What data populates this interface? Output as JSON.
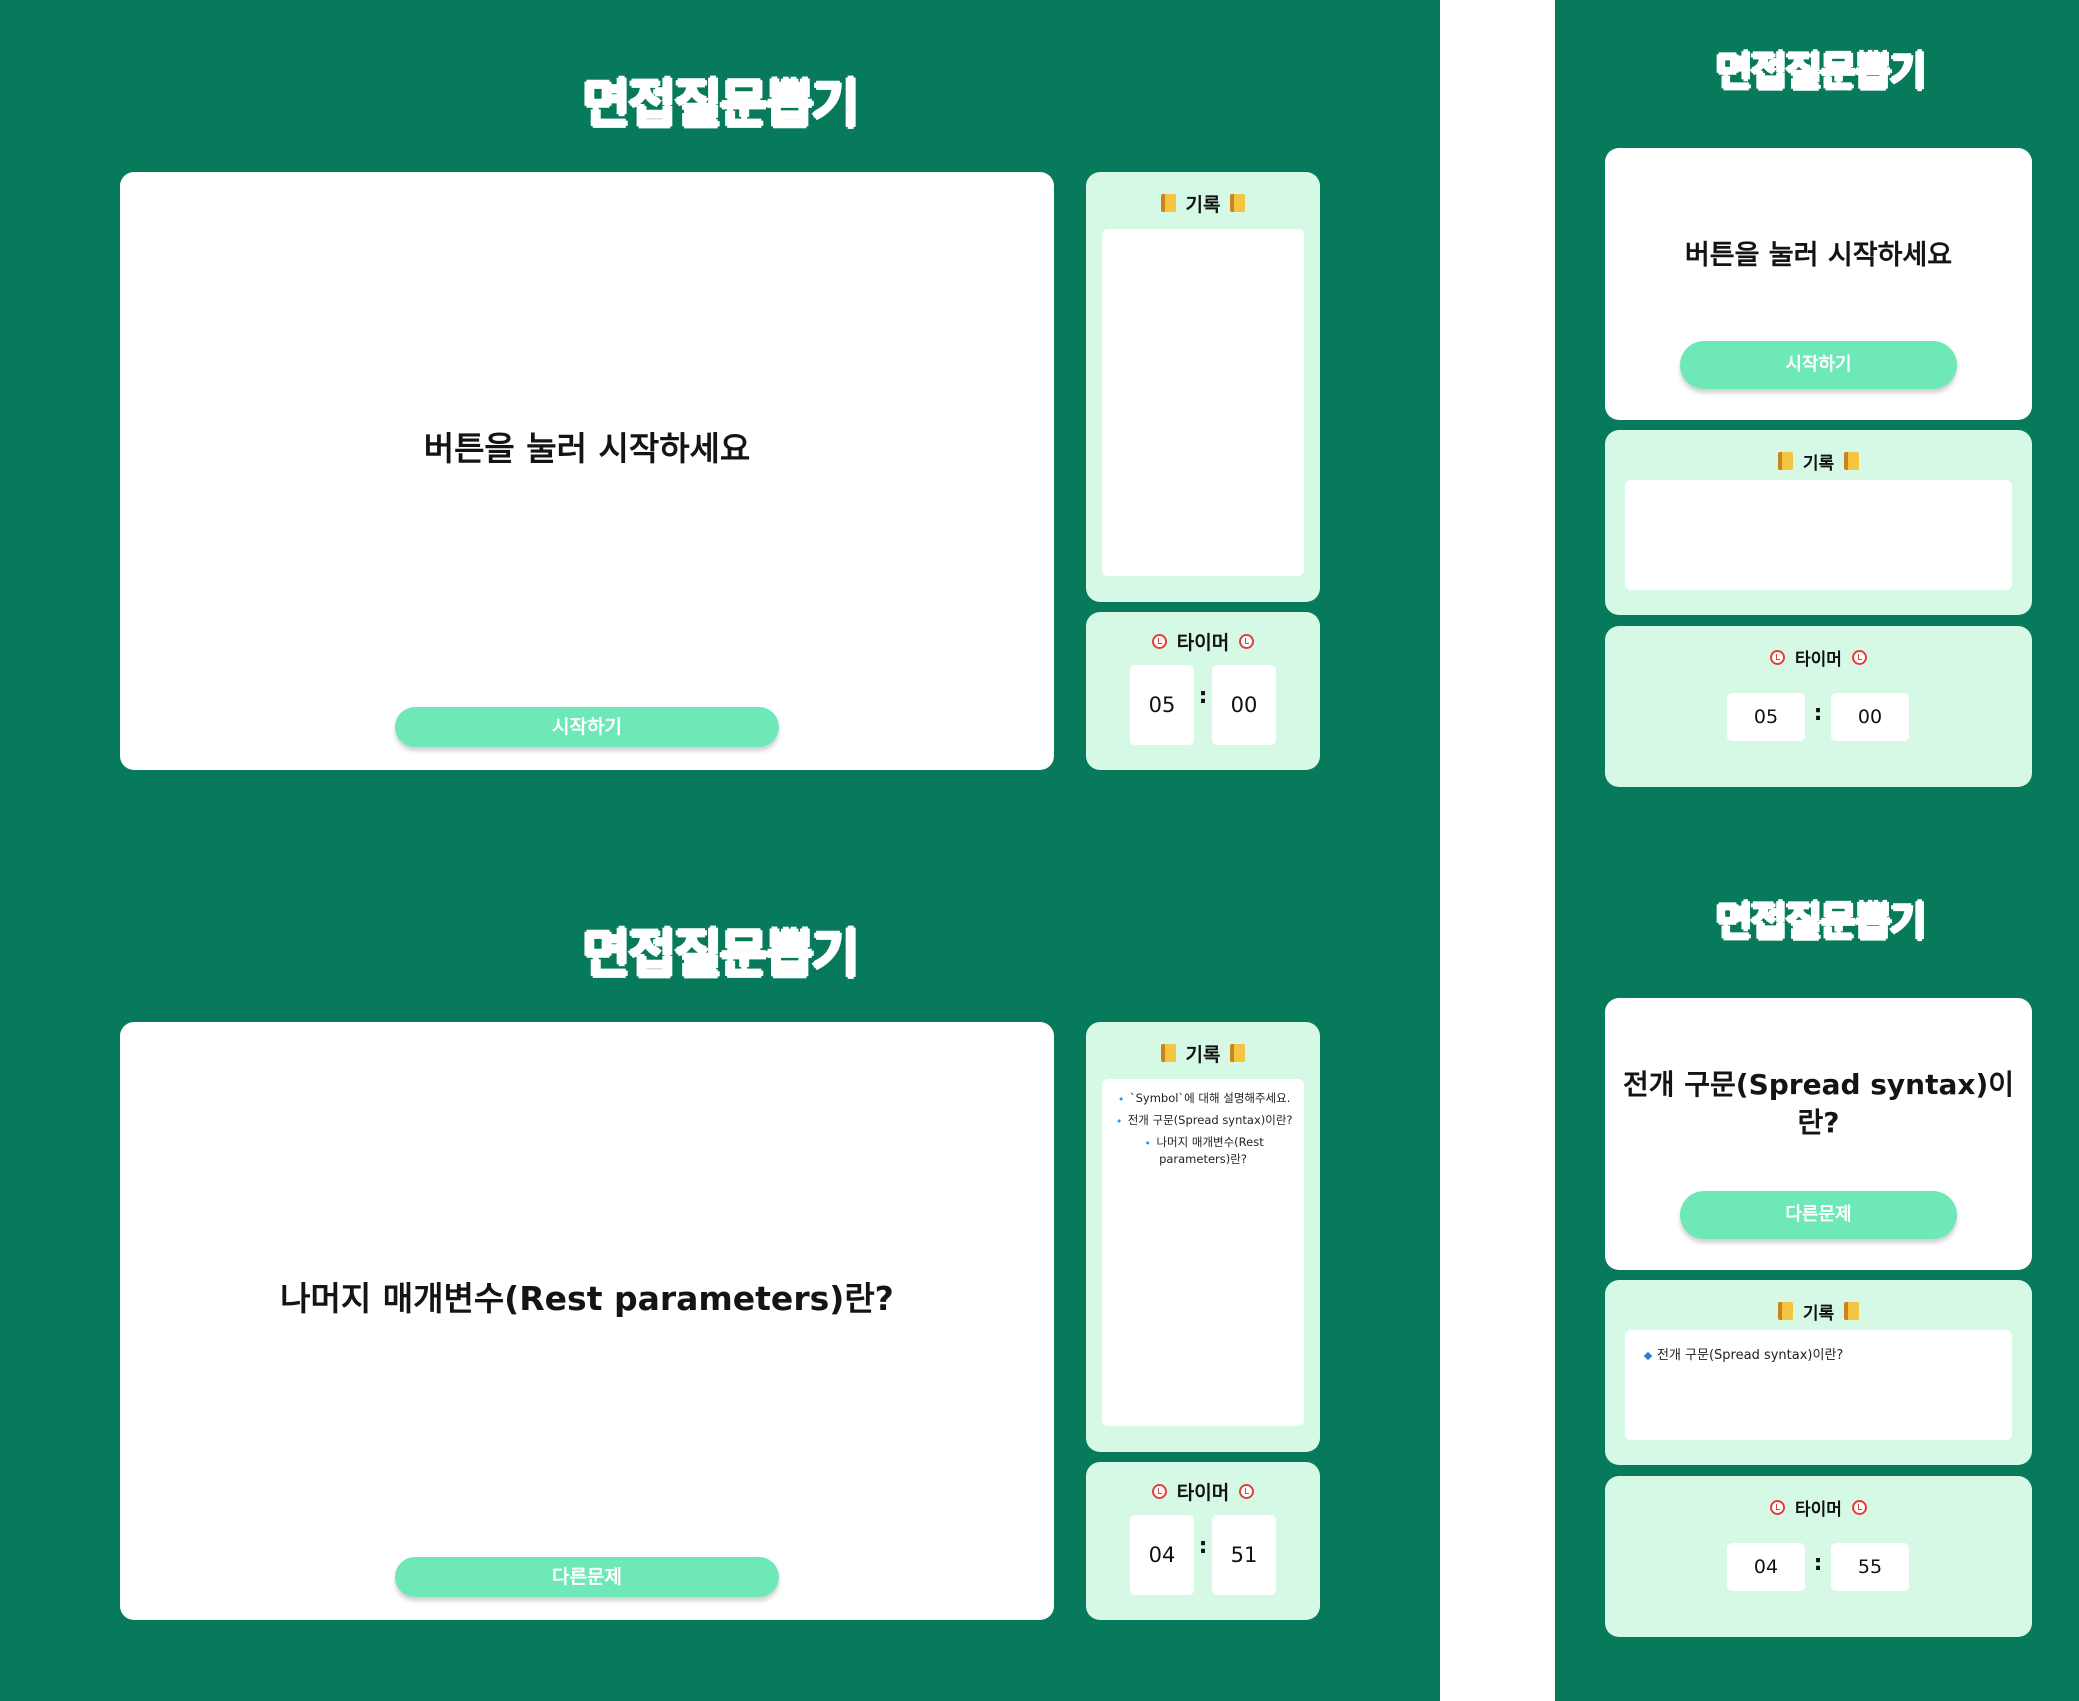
{
  "colors": {
    "background": "#067a5a",
    "accent_button": "#6ee8b6",
    "panel": "#d6f9e6",
    "record_bullet": "#2a7fd4",
    "alarm": "#e0403b"
  },
  "views": [
    {
      "title": "면접질문뽑기",
      "question": "버튼을 눌러 시작하세요",
      "button_label": "시작하기",
      "record": {
        "header": "기록",
        "items": []
      },
      "timer": {
        "header": "타이머",
        "minutes": "05",
        "seconds": "00",
        "separator": ":"
      }
    },
    {
      "title": "면접질문뽑기",
      "question": "나머지 매개변수(Rest parameters)란?",
      "button_label": "다른문제",
      "record": {
        "header": "기록",
        "items": [
          "`Symbol`에 대해 설명해주세요.",
          "전개 구문(Spread syntax)이란?",
          "나머지 매개변수(Rest parameters)란?"
        ]
      },
      "timer": {
        "header": "타이머",
        "minutes": "04",
        "seconds": "51",
        "separator": ":"
      }
    },
    {
      "title": "면접질문뽑기",
      "question": "버튼을 눌러 시작하세요",
      "button_label": "시작하기",
      "record": {
        "header": "기록",
        "items": []
      },
      "timer": {
        "header": "타이머",
        "minutes": "05",
        "seconds": "00",
        "separator": ":"
      }
    },
    {
      "title": "면접질문뽑기",
      "question": "전개 구문(Spread syntax)이란?",
      "button_label": "다른문제",
      "record": {
        "header": "기록",
        "items": [
          "전개 구문(Spread syntax)이란?"
        ]
      },
      "timer": {
        "header": "타이머",
        "minutes": "04",
        "seconds": "55",
        "separator": ":"
      }
    }
  ]
}
